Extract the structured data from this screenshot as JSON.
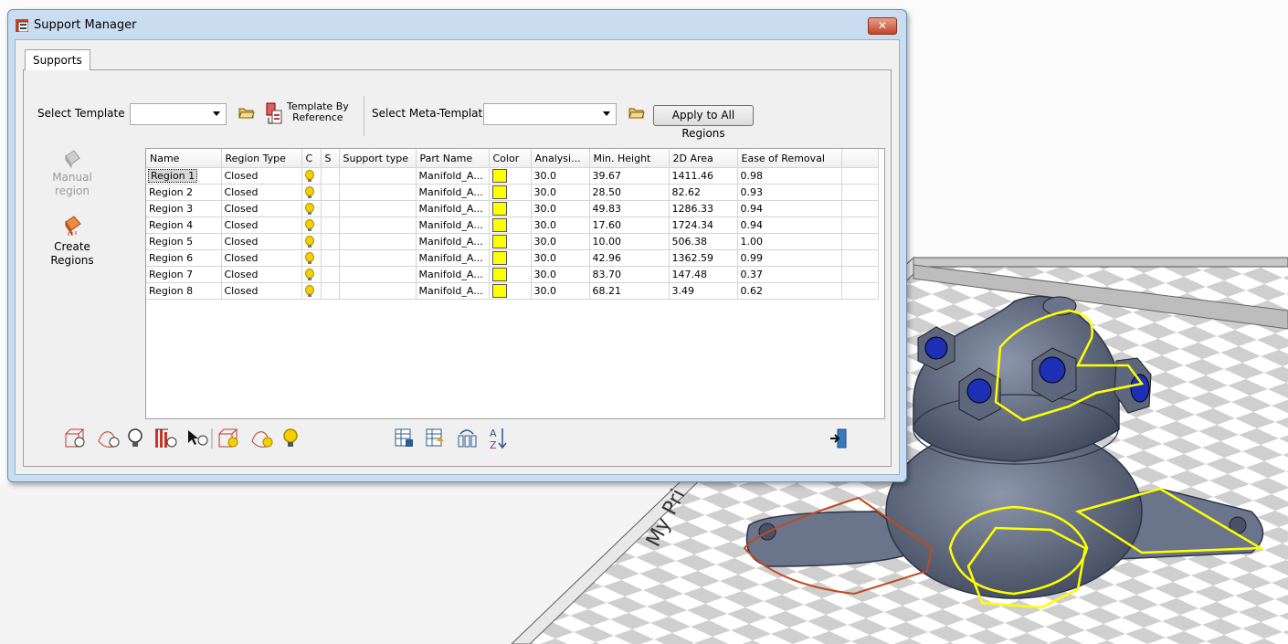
{
  "window": {
    "title": "Support Manager",
    "close_glyph": "✕"
  },
  "tabs": [
    {
      "label": "Supports"
    }
  ],
  "template": {
    "select_label": "Select Template",
    "value": "",
    "by_reference_line1": "Template By",
    "by_reference_line2": "Reference",
    "meta_label": "Select Meta-Template",
    "meta_value": "",
    "apply_all": "Apply to All Regions"
  },
  "side": {
    "manual_line1": "Manual",
    "manual_line2": "region",
    "create_line1": "Create",
    "create_line2": "Regions"
  },
  "table": {
    "columns": [
      "Name",
      "Region Type",
      "C",
      "S",
      "Support type",
      "Part Name",
      "Color",
      "Analysi...",
      "Min. Height",
      "2D Area",
      "Ease of Removal"
    ],
    "rows": [
      {
        "name": "Region 1",
        "type": "Closed",
        "support": "",
        "part": "Manifold_A...",
        "analysis": "30.0",
        "min_height": "39.67",
        "area": "1411.46",
        "ease": "0.98"
      },
      {
        "name": "Region 2",
        "type": "Closed",
        "support": "",
        "part": "Manifold_A...",
        "analysis": "30.0",
        "min_height": "28.50",
        "area": "82.62",
        "ease": "0.93"
      },
      {
        "name": "Region 3",
        "type": "Closed",
        "support": "",
        "part": "Manifold_A...",
        "analysis": "30.0",
        "min_height": "49.83",
        "area": "1286.33",
        "ease": "0.94"
      },
      {
        "name": "Region 4",
        "type": "Closed",
        "support": "",
        "part": "Manifold_A...",
        "analysis": "30.0",
        "min_height": "17.60",
        "area": "1724.34",
        "ease": "0.94"
      },
      {
        "name": "Region 5",
        "type": "Closed",
        "support": "",
        "part": "Manifold_A...",
        "analysis": "30.0",
        "min_height": "10.00",
        "area": "506.38",
        "ease": "1.00"
      },
      {
        "name": "Region 6",
        "type": "Closed",
        "support": "",
        "part": "Manifold_A...",
        "analysis": "30.0",
        "min_height": "42.96",
        "area": "1362.59",
        "ease": "0.99"
      },
      {
        "name": "Region 7",
        "type": "Closed",
        "support": "",
        "part": "Manifold_A...",
        "analysis": "30.0",
        "min_height": "83.70",
        "area": "147.48",
        "ease": "0.37"
      },
      {
        "name": "Region 8",
        "type": "Closed",
        "support": "",
        "part": "Manifold_A...",
        "analysis": "30.0",
        "min_height": "68.21",
        "area": "3.49",
        "ease": "0.62"
      }
    ]
  },
  "scene": {
    "platform_text": "My Pri"
  },
  "colors": {
    "region_color": "#ffff00",
    "selection": "#d8d8d8",
    "title_bar": "#c9dcf0",
    "part": "#5a6478",
    "outline": "#ffff00",
    "manual_outline": "#c04a20"
  },
  "icons": [
    "folder-open-icon",
    "template-by-reference-icon",
    "manual-region-icon",
    "create-regions-icon",
    "bulb-icon",
    "export-icon",
    "sort-az-icon",
    "exit-icon"
  ]
}
